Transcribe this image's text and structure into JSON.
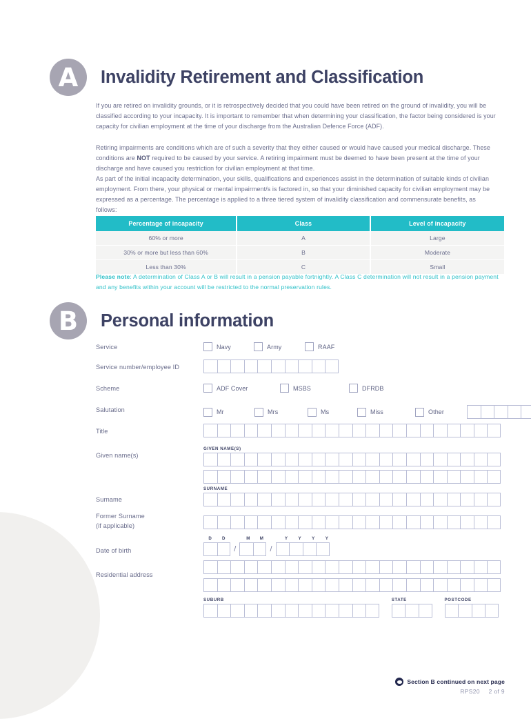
{
  "sections": {
    "a": {
      "badge": "A",
      "title": "Invalidity Retirement and Classification",
      "paragraphs": [
        "If you are retired on invalidity grounds, or it is retrospectively decided that you could have been retired on the ground of invalidity, you will be classified according to your incapacity. It is important to remember that when determining your classification, the factor being considered is your capacity for civilian employment at the time of your discharge from the Australian Defence Force (ADF).",
        "Retiring impairments are conditions which are of such a severity that they either caused or would have caused your medical discharge. These conditions are NOT required to be caused by your service. A retiring impairment must be deemed to have been present at the time of your discharge and have caused you restriction for civilian employment at that time.",
        "As part of the initial incapacity determination, your skills, qualifications and experiences assist in the determination of suitable kinds of civilian employment. From there, your physical or mental impairment/s is factored in, so that your diminished capacity for civilian employment may be expressed as a percentage. The percentage is applied to a three tiered system of invalidity classification and commensurate benefits, as follows:"
      ],
      "para2_pre": "Retiring impairments are conditions which are of such a severity that they either caused or would have caused your medical discharge. These conditions are ",
      "para2_bold": "NOT",
      "para2_post": " required to be caused by your service. A retiring impairment must be deemed to have been present at the time of your discharge and have caused you restriction for civilian employment at that time.",
      "table": {
        "headers": [
          "Percentage of incapacity",
          "Class",
          "Level of incapacity"
        ],
        "rows": [
          [
            "60% or more",
            "A",
            "Large"
          ],
          [
            "30% or more but less than 60%",
            "B",
            "Moderate"
          ],
          [
            "Less than 30%",
            "C",
            "Small"
          ]
        ]
      },
      "note_label": "Please note",
      "note_text": ": A determination of Class A or B will result in a pension payable fortnightly. A Class C determination will not result in a pension payment and any benefits within your account will be restricted to the normal preservation rules."
    },
    "b": {
      "badge": "B",
      "title": "Personal information",
      "fields": {
        "service": {
          "label": "Service",
          "options": [
            "Navy",
            "Army",
            "RAAF"
          ]
        },
        "service_number": {
          "label": "Service number/employee ID",
          "boxes": 10
        },
        "scheme": {
          "label": "Scheme",
          "options": [
            "ADF Cover",
            "MSBS",
            "DFRDB"
          ]
        },
        "salutation": {
          "label": "Salutation",
          "options": [
            "Mr",
            "Mrs",
            "Ms",
            "Miss",
            "Other"
          ],
          "other_boxes": 5
        },
        "title": {
          "label": "Title",
          "boxes": 22
        },
        "given_names": {
          "label": "Given name(s)",
          "sublabel": "GIVEN NAME(S)",
          "boxes": 22,
          "lines": 2
        },
        "surname": {
          "label": "Surname",
          "sublabel": "SURNAME",
          "boxes": 22
        },
        "former_surname": {
          "label": "Former Surname",
          "label2": "(if applicable)",
          "boxes": 22
        },
        "date_of_birth": {
          "label": "Date of birth",
          "day_header": [
            "D",
            "D"
          ],
          "month_header": [
            "M",
            "M"
          ],
          "year_header": [
            "Y",
            "Y",
            "Y",
            "Y"
          ],
          "separator": "/"
        },
        "residential_address": {
          "label": "Residential address",
          "boxes": 22,
          "lines": 2,
          "suburb_label": "SUBURB",
          "suburb_boxes": 13,
          "state_label": "STATE",
          "state_boxes": 3,
          "postcode_label": "POSTCODE",
          "postcode_boxes": 4
        }
      }
    }
  },
  "footer": {
    "continued": "Section B continued on next page",
    "form_code": "RPS20",
    "page": "2 of 9"
  },
  "colors": {
    "teal": "#22bcc7",
    "badge_gray": "#a7a5b2",
    "heading_navy": "#3d4264",
    "body_text": "#6a6d8c",
    "box_border": "#b9bdd6"
  }
}
